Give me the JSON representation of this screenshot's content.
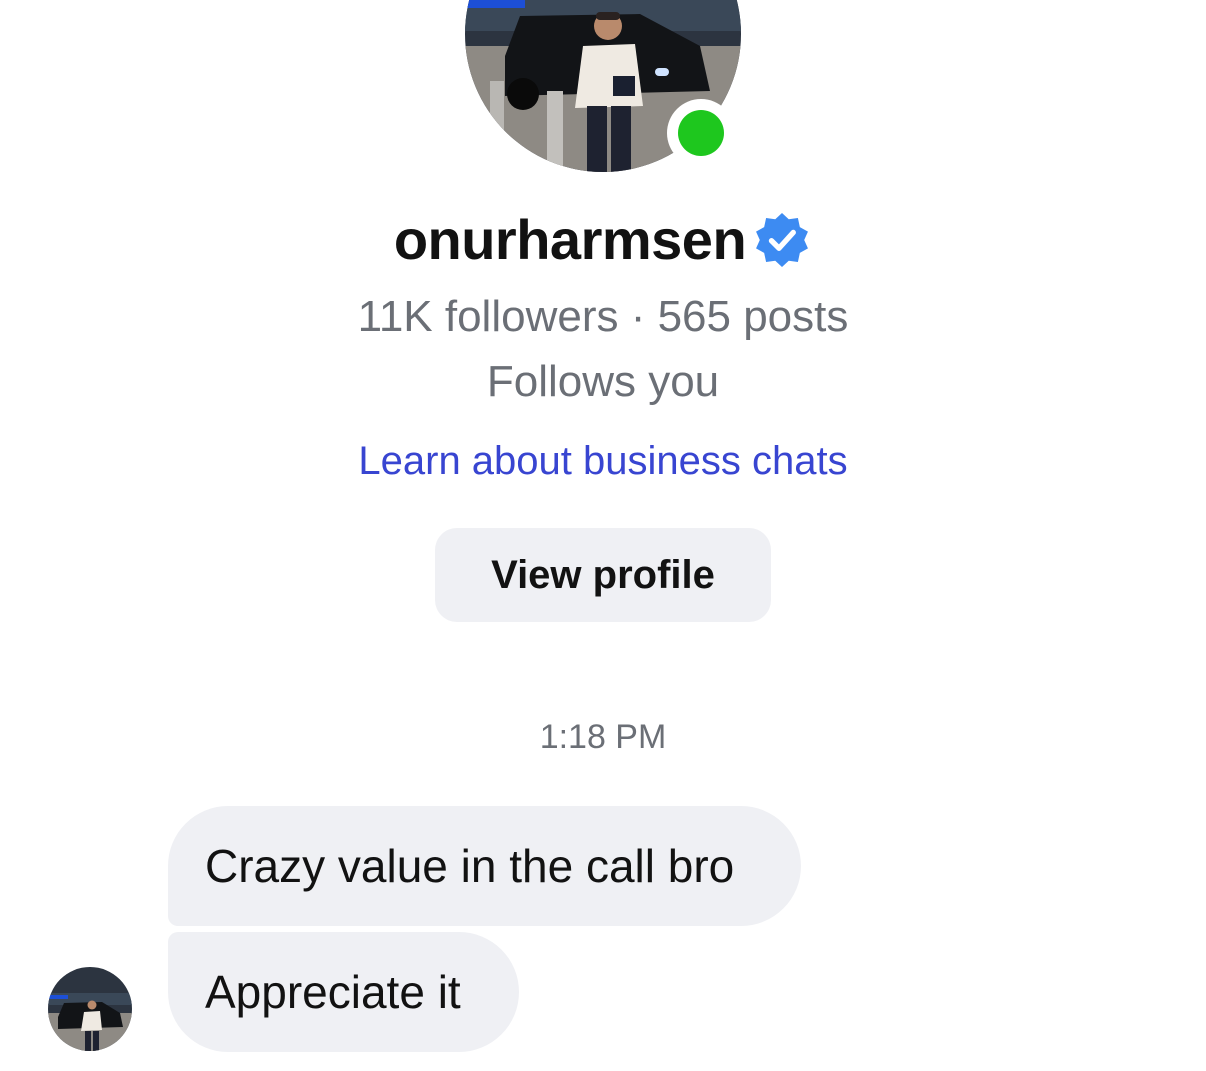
{
  "profile": {
    "username": "onurharmsen",
    "stats": "11K followers · 565 posts",
    "relationship": "Follows you",
    "learn_link": "Learn about business chats",
    "view_profile_label": "View profile",
    "online_status": "online",
    "verified": true
  },
  "conversation": {
    "timestamp": "1:18 PM",
    "messages": [
      {
        "sender": "onurharmsen",
        "text": "Crazy value in the call bro"
      },
      {
        "sender": "onurharmsen",
        "text": "Appreciate it"
      }
    ]
  },
  "icons": {
    "verified": "verified-badge-icon",
    "online": "online-status-dot"
  },
  "colors": {
    "link": "#3845d1",
    "verified_badge": "#3d8bf2",
    "online_dot": "#1ec71e",
    "bubble_bg": "#eff0f4",
    "secondary_text": "#6b6f76"
  }
}
